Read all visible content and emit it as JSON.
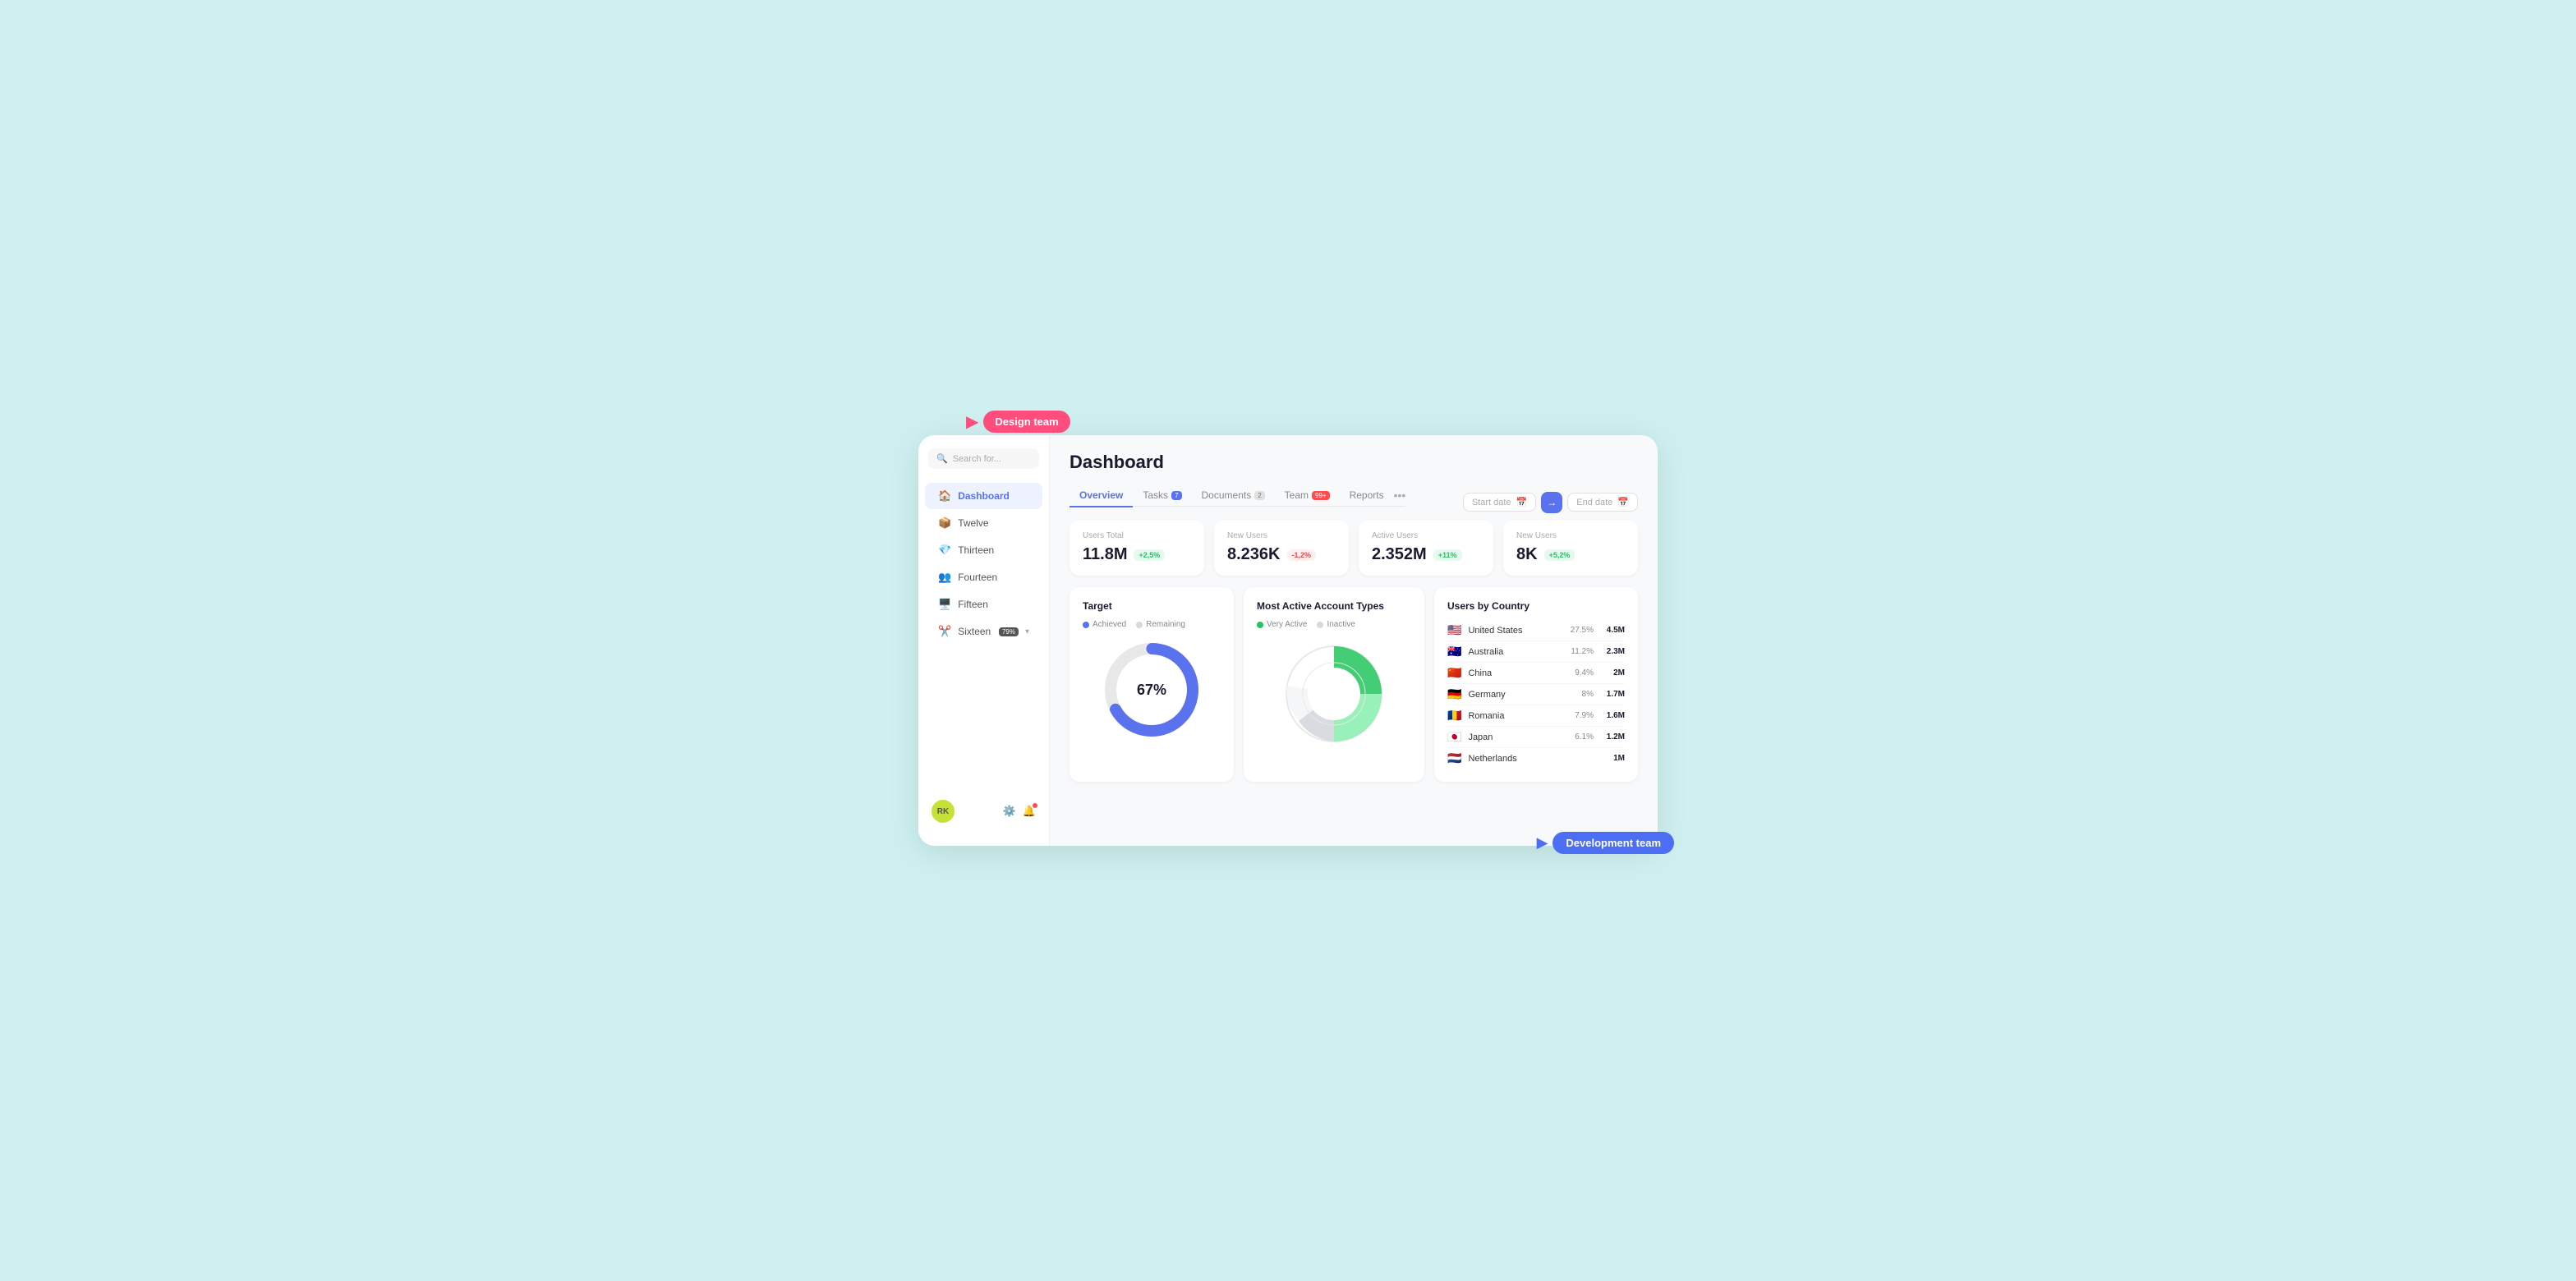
{
  "tooltip_design": {
    "label": "Design team"
  },
  "tooltip_dev": {
    "label": "Development team"
  },
  "sidebar": {
    "search_placeholder": "Search for...",
    "items": [
      {
        "id": "dashboard",
        "label": "Dashboard",
        "icon": "🏠",
        "active": true
      },
      {
        "id": "twelve",
        "label": "Twelve",
        "icon": "📦"
      },
      {
        "id": "thirteen",
        "label": "Thirteen",
        "icon": "💎"
      },
      {
        "id": "fourteen",
        "label": "Fourteen",
        "icon": "👥"
      },
      {
        "id": "fifteen",
        "label": "Fifteen",
        "icon": "🖥️"
      },
      {
        "id": "sixteen",
        "label": "Sixteen",
        "icon": "✂️",
        "badge": "79%"
      }
    ],
    "avatar_initials": "RK"
  },
  "header": {
    "title": "Dashboard"
  },
  "tabs": [
    {
      "id": "overview",
      "label": "Overview",
      "active": true
    },
    {
      "id": "tasks",
      "label": "Tasks",
      "badge": "7",
      "badge_type": "blue"
    },
    {
      "id": "documents",
      "label": "Documents",
      "badge": "2",
      "badge_type": "gray"
    },
    {
      "id": "team",
      "label": "Team",
      "badge": "99+",
      "badge_type": "red"
    },
    {
      "id": "reports",
      "label": "Reports"
    }
  ],
  "date_range": {
    "start_placeholder": "Start date",
    "end_placeholder": "End date"
  },
  "stats": [
    {
      "label": "Users Total",
      "value": "11.8M",
      "badge": "+2,5%",
      "badge_type": "green"
    },
    {
      "label": "New Users",
      "value": "8.236K",
      "badge": "-1,2%",
      "badge_type": "red"
    },
    {
      "label": "Active Users",
      "value": "2.352M",
      "badge": "+11%",
      "badge_type": "green"
    },
    {
      "label": "New Users",
      "value": "8K",
      "badge": "+5,2%",
      "badge_type": "green"
    }
  ],
  "target_widget": {
    "title": "Target",
    "legend_achieved": "Achieved",
    "legend_remaining": "Remaining",
    "percentage": "67%",
    "value": 67
  },
  "pie_widget": {
    "title": "Most Active Account Types",
    "legend_very_active": "Very Active",
    "legend_inactive": "Inactive"
  },
  "country_widget": {
    "title": "Users by Country",
    "countries": [
      {
        "flag": "🇺🇸",
        "name": "United States",
        "pct": "27.5%",
        "val": "4.5M"
      },
      {
        "flag": "🇦🇺",
        "name": "Australia",
        "pct": "11.2%",
        "val": "2.3M"
      },
      {
        "flag": "🇨🇳",
        "name": "China",
        "pct": "9.4%",
        "val": "2M"
      },
      {
        "flag": "🇩🇪",
        "name": "Germany",
        "pct": "8%",
        "val": "1.7M"
      },
      {
        "flag": "🇷🇴",
        "name": "Romania",
        "pct": "7.9%",
        "val": "1.6M"
      },
      {
        "flag": "🇯🇵",
        "name": "Japan",
        "pct": "6.1%",
        "val": "1.2M"
      },
      {
        "flag": "🇳🇱",
        "name": "Netherlands",
        "pct": "",
        "val": "1M"
      }
    ]
  }
}
